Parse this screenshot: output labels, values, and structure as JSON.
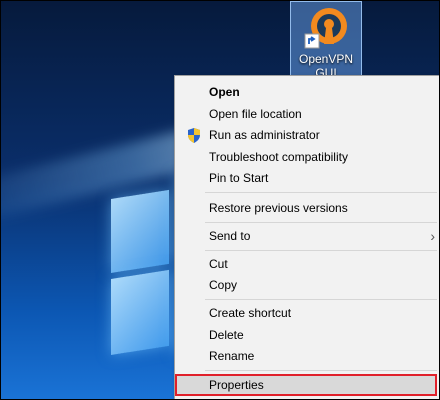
{
  "desktop": {
    "icon": {
      "label": "OpenVPN GUI",
      "icon_name": "openvpn-icon",
      "shortcut_badge": "shortcut-arrow-icon"
    }
  },
  "context_menu": {
    "items": [
      {
        "label": "Open",
        "bold": true
      },
      {
        "label": "Open file location"
      },
      {
        "label": "Run as administrator",
        "icon": "uac-shield-icon"
      },
      {
        "label": "Troubleshoot compatibility"
      },
      {
        "label": "Pin to Start"
      },
      {
        "label": "Restore previous versions"
      },
      {
        "label": "Send to",
        "submenu": true
      },
      {
        "label": "Cut"
      },
      {
        "label": "Copy"
      },
      {
        "label": "Create shortcut"
      },
      {
        "label": "Delete"
      },
      {
        "label": "Rename"
      },
      {
        "label": "Properties",
        "highlighted": true
      }
    ],
    "submenu_arrow": "›",
    "highlight_color": "#e0202a"
  }
}
